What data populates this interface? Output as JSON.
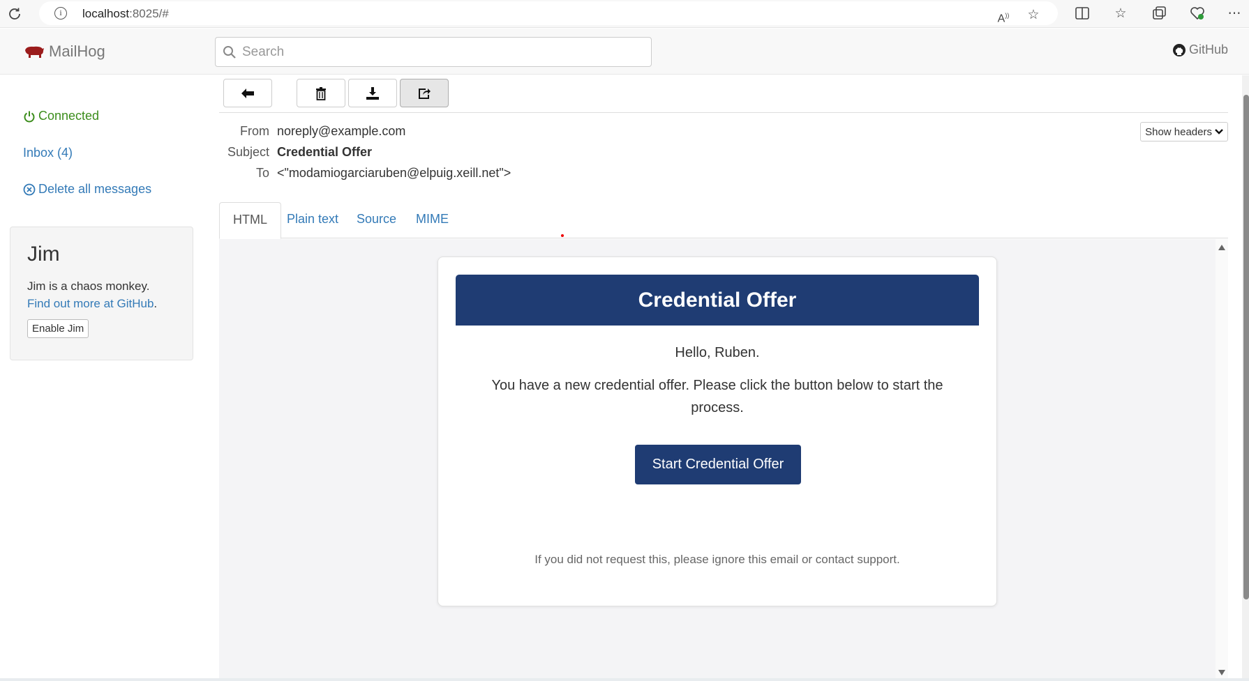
{
  "browser": {
    "url_host": "localhost",
    "url_rest": ":8025/#"
  },
  "navbar": {
    "brand": "MailHog",
    "search_placeholder": "Search",
    "github": "GitHub"
  },
  "sidebar": {
    "connected": "Connected",
    "inbox": "Inbox (4)",
    "delete_all": "Delete all messages",
    "jim": {
      "title": "Jim",
      "text": "Jim is a chaos monkey.",
      "link": "Find out more at GitHub",
      "link_suffix": ".",
      "button": "Enable Jim"
    }
  },
  "message": {
    "from_label": "From",
    "from": "noreply@example.com",
    "subject_label": "Subject",
    "subject": "Credential Offer",
    "to_label": "To",
    "to": "<\"modamiogarciaruben@elpuig.xeill.net\">",
    "show_headers": "Show headers"
  },
  "tabs": [
    "HTML",
    "Plain text",
    "Source",
    "MIME"
  ],
  "email": {
    "header": "Credential Offer",
    "greeting": "Hello, Ruben.",
    "body": "You have a new credential offer. Please click the button below to start the process.",
    "button": "Start Credential Offer",
    "footnote": "If you did not request this, please ignore this email or contact support."
  },
  "colors": {
    "brand_blue": "#1f3c73",
    "link_blue": "#337ab7",
    "connected_green": "#3c8d1c"
  }
}
